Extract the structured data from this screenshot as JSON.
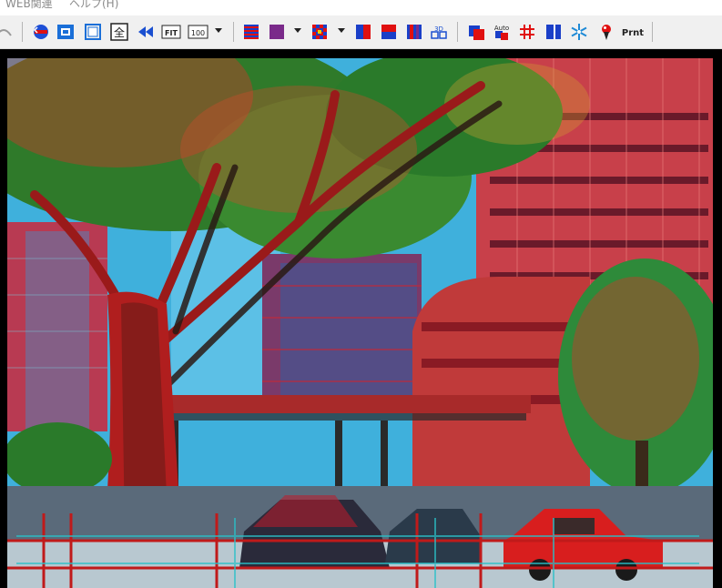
{
  "menubar": {
    "items": [
      {
        "label": "WEB関連"
      },
      {
        "label": "ヘルプ(H)"
      }
    ]
  },
  "toolbar": {
    "fit_label": "FIT",
    "zoom_label": "100",
    "auto_label": "Auto",
    "print_label": "Prnt",
    "full_label": "全"
  },
  "icons": [
    "grip-icon",
    "swap-lr-icon",
    "window-mode-icon",
    "frame-icon",
    "fullscreen-icon",
    "rewind-icon",
    "fit-icon",
    "zoom-100-icon",
    "interlace-icon",
    "checker-icon",
    "mosaic-icon",
    "red-blue-half-icon",
    "red-blue-split-icon",
    "anaglyph-icon",
    "3d-glasses-icon",
    "overlap-icon",
    "auto-adjust-icon",
    "grid-icon",
    "lr-panel-icon",
    "snowflake-icon",
    "marker-pin-icon",
    "print-icon"
  ],
  "colors": {
    "accent_blue": "#1e4fd6",
    "accent_red": "#e01010",
    "anaglyph_cyan": "#2fa6d6",
    "anaglyph_red": "#c81414"
  },
  "image": {
    "description_visible": false
  }
}
